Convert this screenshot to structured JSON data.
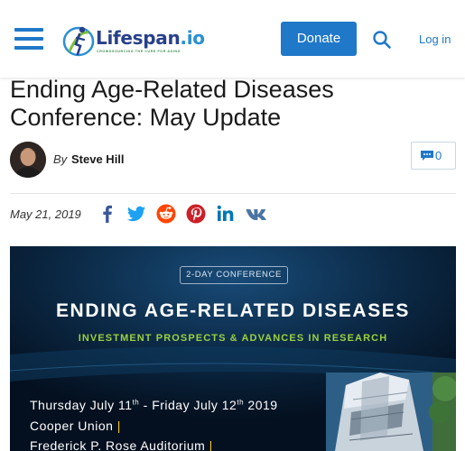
{
  "header": {
    "logo_name": "Lifespan",
    "logo_domain": ".io",
    "logo_tagline": "CROWDSOURCING THE CURE FOR AGING",
    "donate_label": "Donate",
    "login_label": "Log in",
    "accent_color": "#1f78c8"
  },
  "article": {
    "title": "Ending Age-Related Diseases Conference: May Update",
    "by_prefix": "By",
    "author": "Steve Hill",
    "comment_count": "0",
    "date": "May 21, 2019",
    "share_icons": [
      "facebook-icon",
      "twitter-icon",
      "reddit-icon",
      "pinterest-icon",
      "linkedin-icon",
      "vk-icon"
    ]
  },
  "banner": {
    "pill": "2-DAY CONFERENCE",
    "title": "ENDING AGE-RELATED DISEASES",
    "subtitle": "INVESTMENT PROSPECTS & ADVANCES IN RESEARCH",
    "date_start": "Thursday July 11",
    "date_start_suffix": "th",
    "date_sep": " - Friday July 12",
    "date_end_suffix": "th",
    "date_year": " 2019",
    "venue": "Cooper Union",
    "hall": "Frederick P. Rose Auditorium",
    "pipe": "|"
  }
}
